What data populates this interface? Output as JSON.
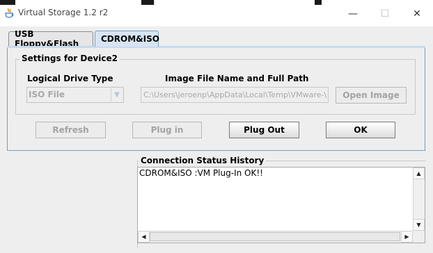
{
  "window": {
    "title": "Virtual Storage 1.2 r2",
    "minimize_glyph": "—",
    "maximize_glyph": "☐",
    "close_glyph": "✕"
  },
  "tabs": [
    {
      "label": "USB Floppy&Flash",
      "selected": false
    },
    {
      "label": "CDROM&ISO",
      "selected": true
    }
  ],
  "settings": {
    "legend": "Settings for Device2",
    "logical_drive_label": "Logical Drive Type",
    "logical_drive_value": "ISO File",
    "image_file_label": "Image File Name and Full Path",
    "image_file_value": "C:\\Users\\jeroenp\\AppData\\Local\\Temp\\VMware-\\",
    "open_image_label": "Open Image"
  },
  "actions": {
    "refresh_label": "Refresh",
    "plugin_label": "Plug in",
    "plugout_label": "Plug Out",
    "ok_label": "OK"
  },
  "history": {
    "legend": "Connection Status History",
    "lines": [
      "CDROM&ISO :VM Plug-In OK!!"
    ]
  },
  "icons": {
    "app": "java-cup-icon",
    "dropdown": "chevron-down-icon"
  },
  "colors": {
    "tab_selected": "#d7e5f3",
    "panel_border": "#7a9bbf",
    "disabled_text": "#a3a3a3"
  }
}
